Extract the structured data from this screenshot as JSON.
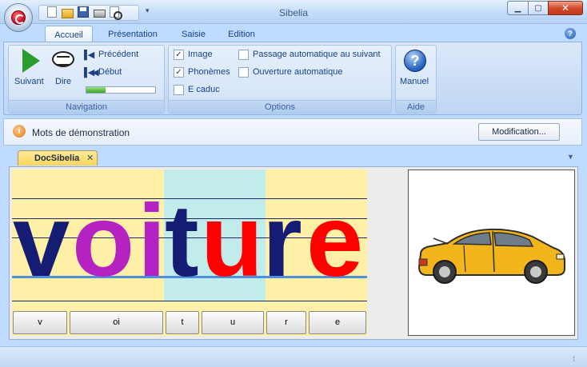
{
  "window": {
    "title": "Sibelia",
    "qat_more": "▾",
    "min_glyph": "▁",
    "max_glyph": "▢",
    "close_glyph": "✕"
  },
  "tabs": [
    {
      "label": "Accueil",
      "active": true
    },
    {
      "label": "Présentation",
      "active": false
    },
    {
      "label": "Saisie",
      "active": false
    },
    {
      "label": "Edition",
      "active": false
    }
  ],
  "help_glyph": "?",
  "ribbon": {
    "navigation": {
      "label": "Navigation",
      "suivant": "Suivant",
      "dire": "Dire",
      "precedent": "Précédent",
      "debut": "Début",
      "progress": 0.28,
      "prev_glyph": "▌◀",
      "start_glyph": "▌◀◀"
    },
    "options": {
      "label": "Options",
      "image": {
        "label": "Image",
        "checked": true
      },
      "phonemes": {
        "label": "Phonèmes",
        "checked": true
      },
      "ecaduc": {
        "label": "E caduc",
        "checked": false
      },
      "passage": {
        "label": "Passage automatique au suivant",
        "checked": false
      },
      "ouverture": {
        "label": "Ouverture automatique",
        "checked": false
      },
      "check_glyph": "✓"
    },
    "aide": {
      "label": "Aide",
      "manuel": "Manuel"
    }
  },
  "message": {
    "icon": "i",
    "text": "Mots de démonstration",
    "button": "Modification..."
  },
  "document": {
    "tab": "DocSibelia",
    "close_glyph": "✕",
    "dropdown_glyph": "▼",
    "letters": [
      {
        "char": "v",
        "color": "#141c73"
      },
      {
        "char": "o",
        "color": "#b522c2"
      },
      {
        "char": "i",
        "color": "#b522c2"
      },
      {
        "char": "t",
        "color": "#141c73"
      },
      {
        "char": "u",
        "color": "#ff0000"
      },
      {
        "char": "r",
        "color": "#141c73"
      },
      {
        "char": "e",
        "color": "#ff0000"
      }
    ],
    "segments": [
      "v",
      "oi",
      "t",
      "u",
      "r",
      "e"
    ]
  },
  "status": {
    "grip": "⁞⁞"
  }
}
